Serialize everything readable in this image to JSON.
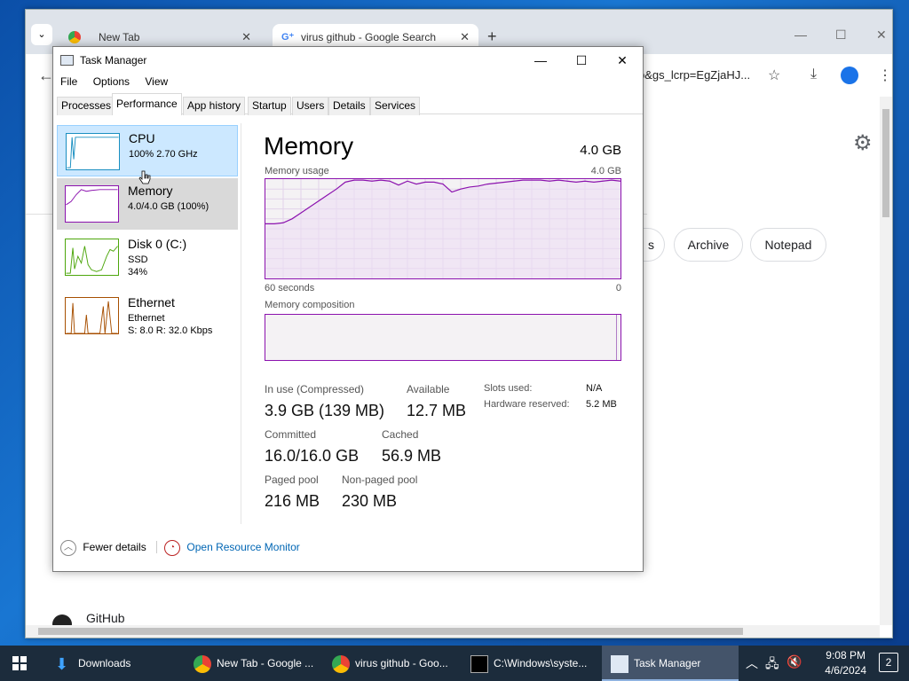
{
  "chrome": {
    "tabs": [
      {
        "title": "New Tab"
      },
      {
        "title": "virus github - Google Search"
      }
    ],
    "url_fragment": "b&gs_lcrp=EgZjaHJ...",
    "chips": [
      "s",
      "Archive",
      "Notepad"
    ],
    "github_label": "GitHub"
  },
  "taskmanager": {
    "title": "Task Manager",
    "menu": [
      "File",
      "Options",
      "View"
    ],
    "tabs": [
      "Processes",
      "Performance",
      "App history",
      "Startup",
      "Users",
      "Details",
      "Services"
    ],
    "side": [
      {
        "name": "CPU",
        "sub1": "100%  2.70 GHz",
        "sub2": ""
      },
      {
        "name": "Memory",
        "sub1": "4.0/4.0 GB (100%)",
        "sub2": ""
      },
      {
        "name": "Disk 0 (C:)",
        "sub1": "SSD",
        "sub2": "34%"
      },
      {
        "name": "Ethernet",
        "sub1": "Ethernet",
        "sub2": "S: 8.0  R: 32.0 Kbps"
      }
    ],
    "main": {
      "title": "Memory",
      "capacity": "4.0 GB",
      "usage_label": "Memory usage",
      "usage_max": "4.0 GB",
      "time_left": "60 seconds",
      "time_right": "0",
      "composition_label": "Memory composition"
    },
    "stats": {
      "in_use_label": "In use (Compressed)",
      "in_use": "3.9 GB (139 MB)",
      "available_label": "Available",
      "available": "12.7 MB",
      "slots_label": "Slots used:",
      "slots": "N/A",
      "hw_label": "Hardware reserved:",
      "hw": "5.2 MB",
      "committed_label": "Committed",
      "committed": "16.0/16.0 GB",
      "cached_label": "Cached",
      "cached": "56.9 MB",
      "paged_label": "Paged pool",
      "paged": "216 MB",
      "nonpaged_label": "Non-paged pool",
      "nonpaged": "230 MB"
    },
    "footer": {
      "fewer": "Fewer details",
      "resmon": "Open Resource Monitor"
    },
    "memory_usage_series": [
      0.55,
      0.55,
      0.56,
      0.6,
      0.66,
      0.72,
      0.78,
      0.84,
      0.9,
      0.97,
      0.99,
      0.99,
      0.98,
      0.99,
      0.98,
      0.94,
      0.98,
      0.95,
      0.97,
      0.97,
      0.95,
      0.87,
      0.9,
      0.92,
      0.93,
      0.95,
      0.96,
      0.97,
      0.98,
      0.99,
      0.99,
      0.99,
      0.98,
      0.99,
      0.98,
      0.97,
      0.98,
      0.97,
      0.98,
      0.99,
      0.98
    ]
  },
  "taskbar": {
    "items": [
      "Downloads",
      "New Tab - Google ...",
      "virus github - Goo...",
      "C:\\Windows\\syste...",
      "Task Manager"
    ],
    "time": "9:08 PM",
    "date": "4/6/2024",
    "notifications": "2"
  }
}
